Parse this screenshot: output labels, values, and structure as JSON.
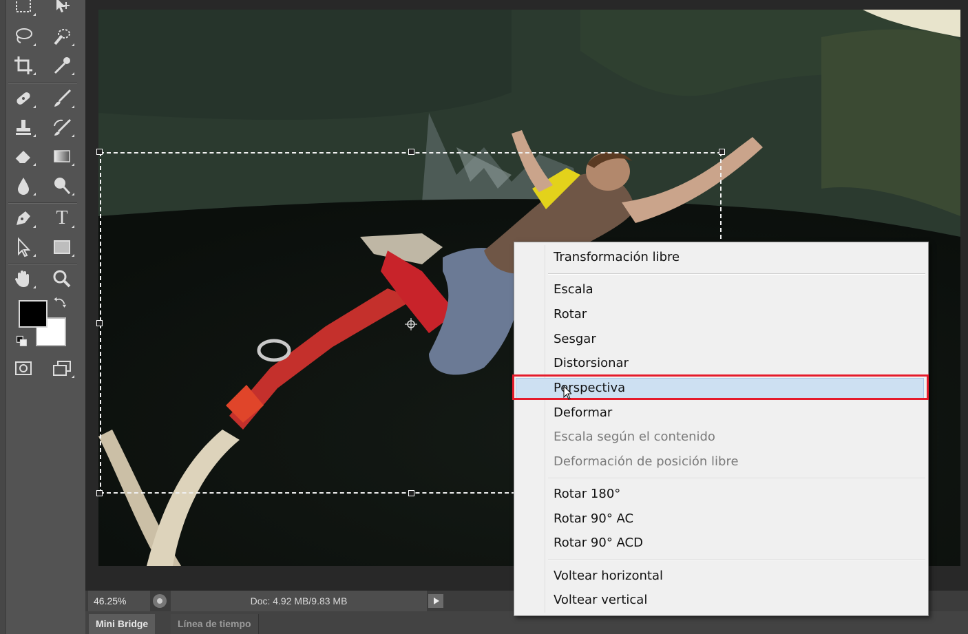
{
  "toolbar": {
    "tools": [
      "marquee-tool",
      "move-tool",
      "lasso-tool",
      "quick-selection-tool",
      "crop-tool",
      "eyedropper-tool",
      "spot-healing-tool",
      "brush-tool",
      "clone-stamp-tool",
      "history-brush-tool",
      "eraser-tool",
      "gradient-tool",
      "blur-tool",
      "dodge-tool",
      "pen-tool",
      "type-tool",
      "path-selection-tool",
      "rectangle-tool",
      "hand-tool",
      "zoom-tool"
    ],
    "type_tool_glyph": "T",
    "foreground_color": "#000000",
    "background_color": "#ffffff"
  },
  "status_bar": {
    "zoom": "46.25%",
    "doc_info": "Doc: 4.92 MB/9.83 MB"
  },
  "panel_tabs": {
    "mini_bridge": "Mini Bridge",
    "timeline": "Línea de tiempo"
  },
  "context_menu": {
    "items": [
      {
        "label": "Transformación libre",
        "enabled": true
      },
      {
        "label": "Escala",
        "enabled": true
      },
      {
        "label": "Rotar",
        "enabled": true
      },
      {
        "label": "Sesgar",
        "enabled": true
      },
      {
        "label": "Distorsionar",
        "enabled": true
      },
      {
        "label": "Perspectiva",
        "enabled": true,
        "highlighted": true
      },
      {
        "label": "Deformar",
        "enabled": true
      },
      {
        "label": "Escala según el contenido",
        "enabled": false
      },
      {
        "label": "Deformación de posición libre",
        "enabled": false
      },
      {
        "label": "Rotar 180°",
        "enabled": true
      },
      {
        "label": "Rotar 90° AC",
        "enabled": true
      },
      {
        "label": "Rotar 90° ACD",
        "enabled": true
      },
      {
        "label": "Voltear horizontal",
        "enabled": true
      },
      {
        "label": "Voltear vertical",
        "enabled": true
      }
    ],
    "highlight_color": "#cde0f2",
    "annotation_color": "#e51b2b"
  }
}
